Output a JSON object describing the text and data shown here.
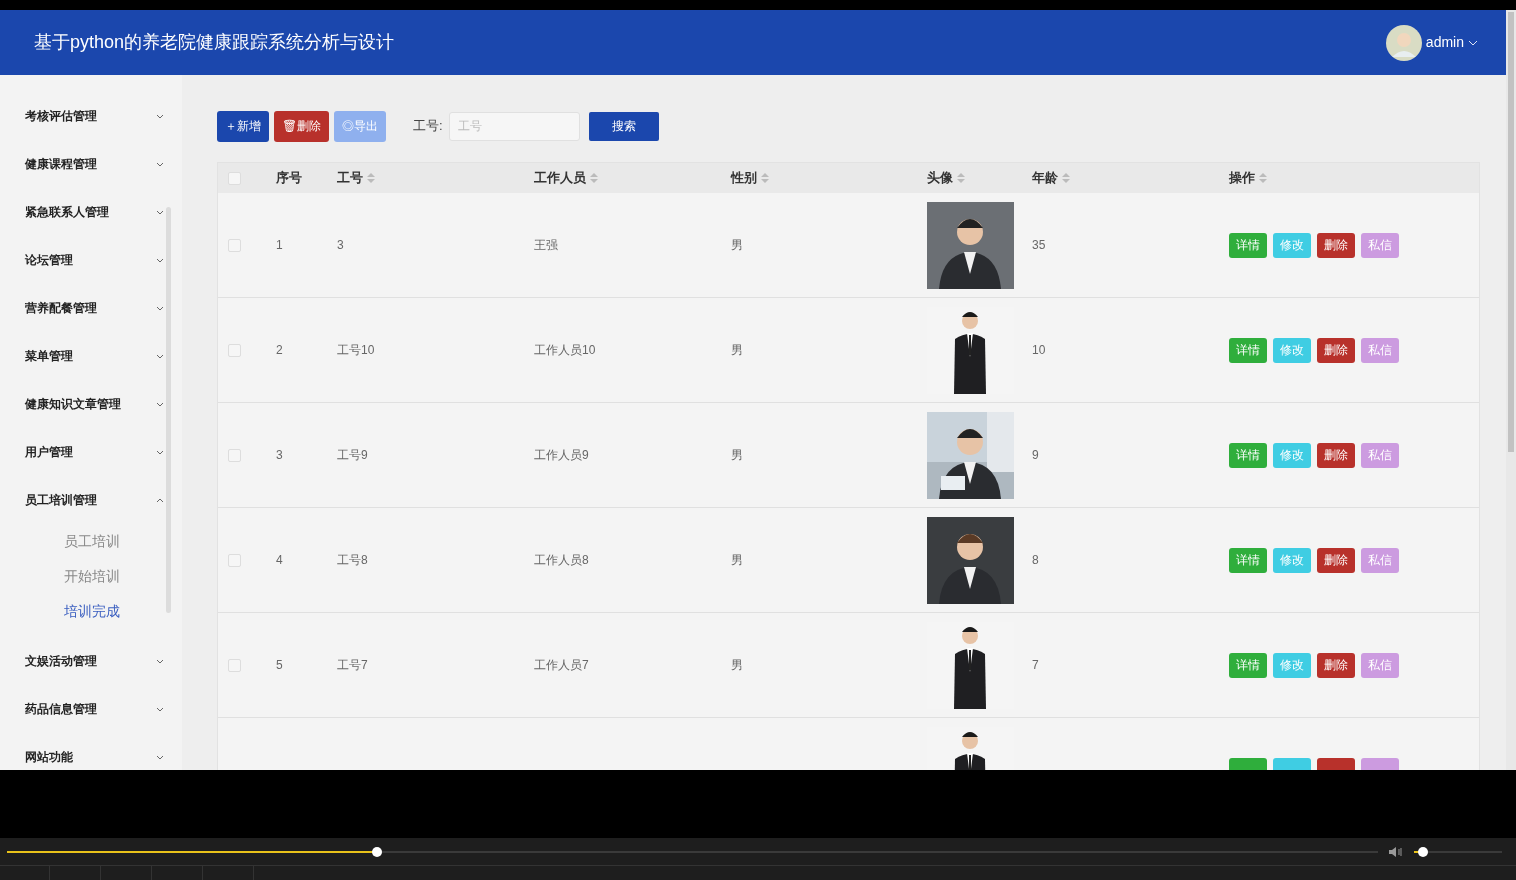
{
  "header": {
    "title": "基于python的养老院健康跟踪系统分析与设计",
    "user": "admin"
  },
  "sidebar": {
    "items": [
      {
        "label": "考核评估管理",
        "expanded": false
      },
      {
        "label": "健康课程管理",
        "expanded": false
      },
      {
        "label": "紧急联系人管理",
        "expanded": false
      },
      {
        "label": "论坛管理",
        "expanded": false
      },
      {
        "label": "营养配餐管理",
        "expanded": false
      },
      {
        "label": "菜单管理",
        "expanded": false
      },
      {
        "label": "健康知识文章管理",
        "expanded": false
      },
      {
        "label": "用户管理",
        "expanded": false
      },
      {
        "label": "员工培训管理",
        "expanded": true,
        "children": [
          {
            "label": "员工培训",
            "selected": false
          },
          {
            "label": "开始培训",
            "selected": false
          },
          {
            "label": "培训完成",
            "selected": true
          }
        ]
      },
      {
        "label": "文娱活动管理",
        "expanded": false
      },
      {
        "label": "药品信息管理",
        "expanded": false
      },
      {
        "label": "网站功能",
        "expanded": false
      }
    ]
  },
  "toolbar": {
    "buttons": [
      {
        "label": "新增",
        "icon": "＋",
        "kind": "add"
      },
      {
        "label": "删除",
        "icon": "🗑",
        "kind": "delete"
      },
      {
        "label": "导出",
        "icon": "◎",
        "kind": "export"
      }
    ],
    "search_label": "工号:",
    "search_placeholder": "工号",
    "search_button": "搜索"
  },
  "table": {
    "columns": [
      {
        "label": "序号",
        "sortable": false
      },
      {
        "label": "工号",
        "sortable": true
      },
      {
        "label": "工作人员",
        "sortable": true
      },
      {
        "label": "性别",
        "sortable": true
      },
      {
        "label": "头像",
        "sortable": true
      },
      {
        "label": "年龄",
        "sortable": true
      },
      {
        "label": "操作",
        "sortable": true
      }
    ],
    "select_all_checked": false,
    "rows": [
      {
        "checked": false,
        "index": "1",
        "id": "3",
        "name": "王强",
        "gender": "男",
        "age": "35",
        "actions": [
          {
            "label": "详情",
            "kind": "detail"
          },
          {
            "label": "修改",
            "kind": "edit"
          },
          {
            "label": "删除",
            "kind": "delete"
          },
          {
            "label": "私信",
            "kind": "message"
          }
        ]
      },
      {
        "checked": false,
        "index": "2",
        "id": "工号10",
        "name": "工作人员10",
        "gender": "男",
        "age": "10",
        "actions": [
          {
            "label": "详情",
            "kind": "detail"
          },
          {
            "label": "修改",
            "kind": "edit"
          },
          {
            "label": "删除",
            "kind": "delete"
          },
          {
            "label": "私信",
            "kind": "message"
          }
        ]
      },
      {
        "checked": false,
        "index": "3",
        "id": "工号9",
        "name": "工作人员9",
        "gender": "男",
        "age": "9",
        "actions": [
          {
            "label": "详情",
            "kind": "detail"
          },
          {
            "label": "修改",
            "kind": "edit"
          },
          {
            "label": "删除",
            "kind": "delete"
          },
          {
            "label": "私信",
            "kind": "message"
          }
        ]
      },
      {
        "checked": false,
        "index": "4",
        "id": "工号8",
        "name": "工作人员8",
        "gender": "男",
        "age": "8",
        "actions": [
          {
            "label": "详情",
            "kind": "detail"
          },
          {
            "label": "修改",
            "kind": "edit"
          },
          {
            "label": "删除",
            "kind": "delete"
          },
          {
            "label": "私信",
            "kind": "message"
          }
        ]
      },
      {
        "checked": false,
        "index": "5",
        "id": "工号7",
        "name": "工作人员7",
        "gender": "男",
        "age": "7",
        "actions": [
          {
            "label": "详情",
            "kind": "detail"
          },
          {
            "label": "修改",
            "kind": "edit"
          },
          {
            "label": "删除",
            "kind": "delete"
          },
          {
            "label": "私信",
            "kind": "message"
          }
        ]
      },
      {
        "actions": [
          {
            "kind": "detail"
          },
          {
            "kind": "edit"
          },
          {
            "kind": "delete"
          },
          {
            "kind": "message"
          }
        ]
      }
    ]
  },
  "player": {
    "progress": {
      "level": 0.27
    },
    "volume": {
      "level": 0.1
    }
  }
}
